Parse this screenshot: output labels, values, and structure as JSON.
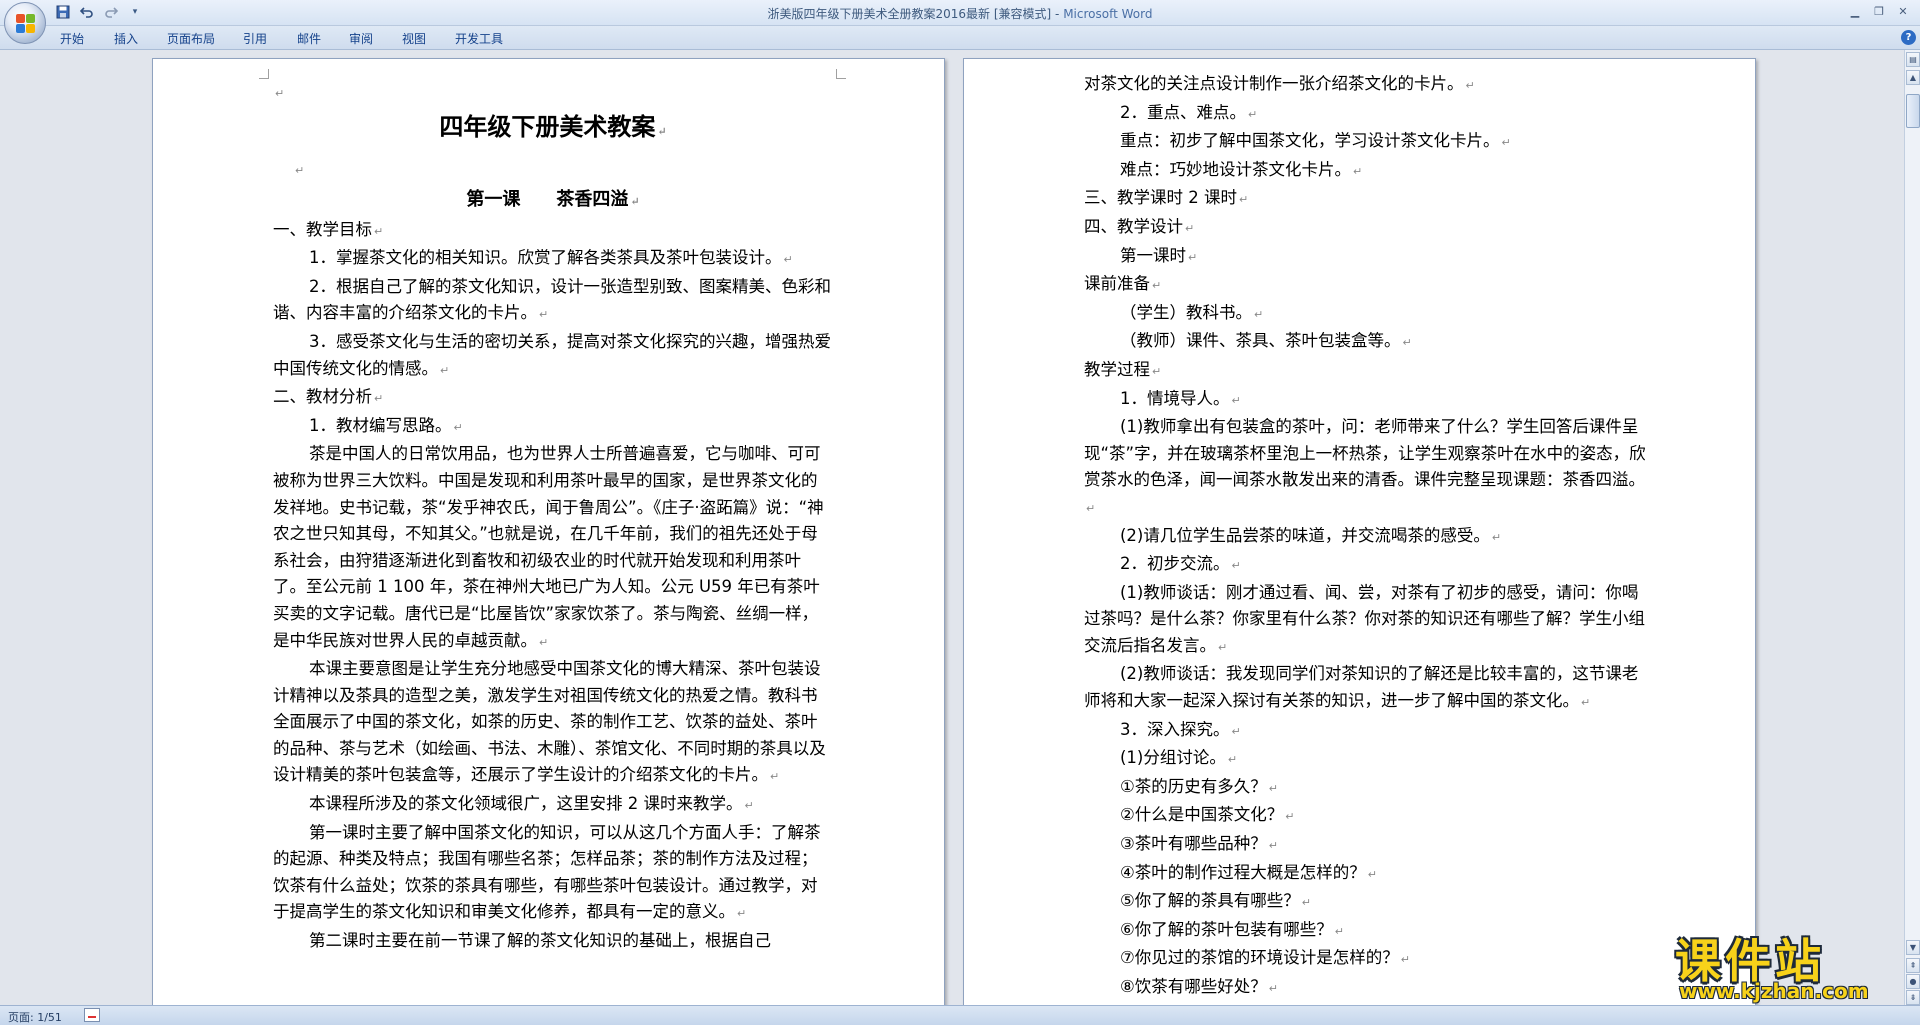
{
  "window": {
    "title": "浙美版四年级下册美术全册教案2016最新 [兼容模式] - ",
    "app_name": "Microsoft Word"
  },
  "quick_access": [
    "save-icon",
    "undo-icon",
    "redo-icon",
    "customize-icon"
  ],
  "ribbon": {
    "tabs": [
      "开始",
      "插入",
      "页面布局",
      "引用",
      "邮件",
      "审阅",
      "视图",
      "开发工具"
    ]
  },
  "left_page": {
    "doc_title": "四年级下册美术教案",
    "lesson_title": "第一课　　茶香四溢",
    "lines": [
      {
        "text": "一、教学目标",
        "indent": false
      },
      {
        "text": "1．掌握茶文化的相关知识。欣赏了解各类茶具及茶叶包装设计。",
        "indent": true
      },
      {
        "text": "2．根据自己了解的茶文化知识，设计一张造型别致、图案精美、色彩和谐、内容丰富的介绍茶文化的卡片。",
        "indent": true
      },
      {
        "text": "3．感受茶文化与生活的密切关系，提高对茶文化探究的兴趣，增强热爱中国传统文化的情感。",
        "indent": true
      },
      {
        "text": "二、教材分析",
        "indent": false
      },
      {
        "text": "1．教材编写思路。",
        "indent": true
      },
      {
        "text": "茶是中国人的日常饮用品，也为世界人士所普遍喜爱，它与咖啡、可可被称为世界三大饮料。中国是发现和利用茶叶最早的国家，是世界茶文化的发祥地。史书记载，茶“发乎神农氏，闻于鲁周公”。《庄子·盗跖篇》说：“神农之世只知其母，不知其父。”也就是说，在几千年前，我们的祖先还处于母系社会，由狩猎逐渐进化到畜牧和初级农业的时代就开始发现和利用茶叶了。至公元前 1 100 年，茶在神州大地已广为人知。公元 U59 年已有茶叶买卖的文字记载。唐代已是“比屋皆饮”家家饮茶了。茶与陶瓷、丝绸一样，是中华民族对世界人民的卓越贡献。",
        "indent": true
      },
      {
        "text": "本课主要意图是让学生充分地感受中国茶文化的博大精深、茶叶包装设计精神以及茶具的造型之美，激发学生对祖国传统文化的热爱之情。教科书全面展示了中国的茶文化，如茶的历史、茶的制作工艺、饮茶的益处、茶叶的品种、茶与艺术（如绘画、书法、木雕）、茶馆文化、不同时期的茶具以及设计精美的茶叶包装盒等，还展示了学生设计的介绍茶文化的卡片。",
        "indent": true
      },
      {
        "text": "本课程所涉及的茶文化领域很广，这里安排 2 课时来教学。",
        "indent": true
      },
      {
        "text": "第一课时主要了解中国茶文化的知识，可以从这几个方面人手：了解茶的起源、种类及特点；我国有哪些名茶；怎样品茶；茶的制作方法及过程；饮茶有什么益处；饮茶的茶具有哪些，有哪些茶叶包装设计。通过教学，对于提高学生的茶文化知识和审美文化修养，都具有一定的意义。",
        "indent": true
      },
      {
        "text": "第二课时主要在前一节课了解的茶文化知识的基础上，根据自己",
        "indent": true,
        "no_mark": true
      }
    ]
  },
  "right_page": {
    "lines": [
      {
        "text": "对茶文化的关注点设计制作一张介绍茶文化的卡片。",
        "indent": false
      },
      {
        "text": "2．重点、难点。",
        "indent": true
      },
      {
        "text": "重点：初步了解中国茶文化，学习设计茶文化卡片。",
        "indent": true
      },
      {
        "text": "难点：巧妙地设计茶文化卡片。",
        "indent": true
      },
      {
        "text": "三、教学课时 2 课时",
        "indent": false
      },
      {
        "text": "四、教学设计",
        "indent": false
      },
      {
        "text": "第一课时",
        "indent": true
      },
      {
        "text": "课前准备",
        "indent": false
      },
      {
        "text": "（学生）教科书。",
        "indent": true
      },
      {
        "text": "（教师）课件、茶具、茶叶包装盒等。",
        "indent": true
      },
      {
        "text": "教学过程",
        "indent": false
      },
      {
        "text": "1．情境导人。",
        "indent": true
      },
      {
        "text": "(1)教师拿出有包装盒的茶叶，问：老师带来了什么？学生回答后课件呈现“茶”字，并在玻璃茶杯里泡上一杯热茶，让学生观察茶叶在水中的姿态，欣赏茶水的色泽，闻一闻茶水散发出来的清香。课件完整呈现课题：茶香四溢。",
        "indent": true
      },
      {
        "text": "(2)请几位学生品尝茶的味道，并交流喝茶的感受。",
        "indent": true
      },
      {
        "text": "2．初步交流。",
        "indent": true
      },
      {
        "text": "(1)教师谈话：刚才通过看、闻、尝，对茶有了初步的感受，请问：你喝过茶吗？是什么茶？你家里有什么茶？你对茶的知识还有哪些了解？学生小组交流后指名发言。",
        "indent": true
      },
      {
        "text": "(2)教师谈话：我发现同学们对茶知识的了解还是比较丰富的，这节课老师将和大家一起深入探讨有关茶的知识，进一步了解中国的茶文化。",
        "indent": true
      },
      {
        "text": "3．深入探究。",
        "indent": true
      },
      {
        "text": "(1)分组讨论。",
        "indent": true
      },
      {
        "text": "①茶的历史有多久？",
        "indent": true
      },
      {
        "text": "②什么是中国茶文化？",
        "indent": true
      },
      {
        "text": "③茶叶有哪些品种？",
        "indent": true
      },
      {
        "text": "④茶叶的制作过程大概是怎样的？",
        "indent": true
      },
      {
        "text": "⑤你了解的茶具有哪些？",
        "indent": true
      },
      {
        "text": "⑥你了解的茶叶包装有哪些？",
        "indent": true
      },
      {
        "text": "⑦你见过的茶馆的环境设计是怎样的？",
        "indent": true
      },
      {
        "text": "⑧饮茶有哪些好处？",
        "indent": true
      }
    ]
  },
  "paragraph_mark": "↵",
  "status": {
    "page_info": "页面: 1/51"
  },
  "watermark": {
    "brand": "课件站",
    "url": "www.kjzhan.com"
  },
  "colors": {
    "title_accent": "#4a6fa5",
    "tab_text": "#15428b",
    "watermark_fill": "#f7d21a"
  }
}
